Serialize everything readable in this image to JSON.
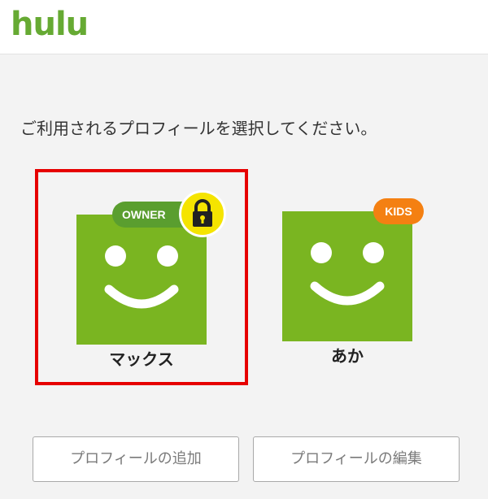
{
  "header": {
    "logo_text": "hulu",
    "logo_color": "#66aa33"
  },
  "prompt": {
    "text": "ご利用されるプロフィールを選択してください。"
  },
  "profiles": [
    {
      "name": "マックス",
      "badge": "OWNER",
      "badge_color": "#5a9e2f",
      "locked": true,
      "lock_icon": "lock-icon",
      "lock_color": "#f5e400",
      "selected": true,
      "selected_border_color": "#e60000",
      "avatar_color": "#7ab521"
    },
    {
      "name": "あか",
      "badge": "KIDS",
      "badge_color": "#f48012",
      "locked": false,
      "selected": false,
      "avatar_color": "#7ab521"
    }
  ],
  "buttons": {
    "add_profile": "プロフィールの追加",
    "edit_profile": "プロフィールの編集"
  }
}
